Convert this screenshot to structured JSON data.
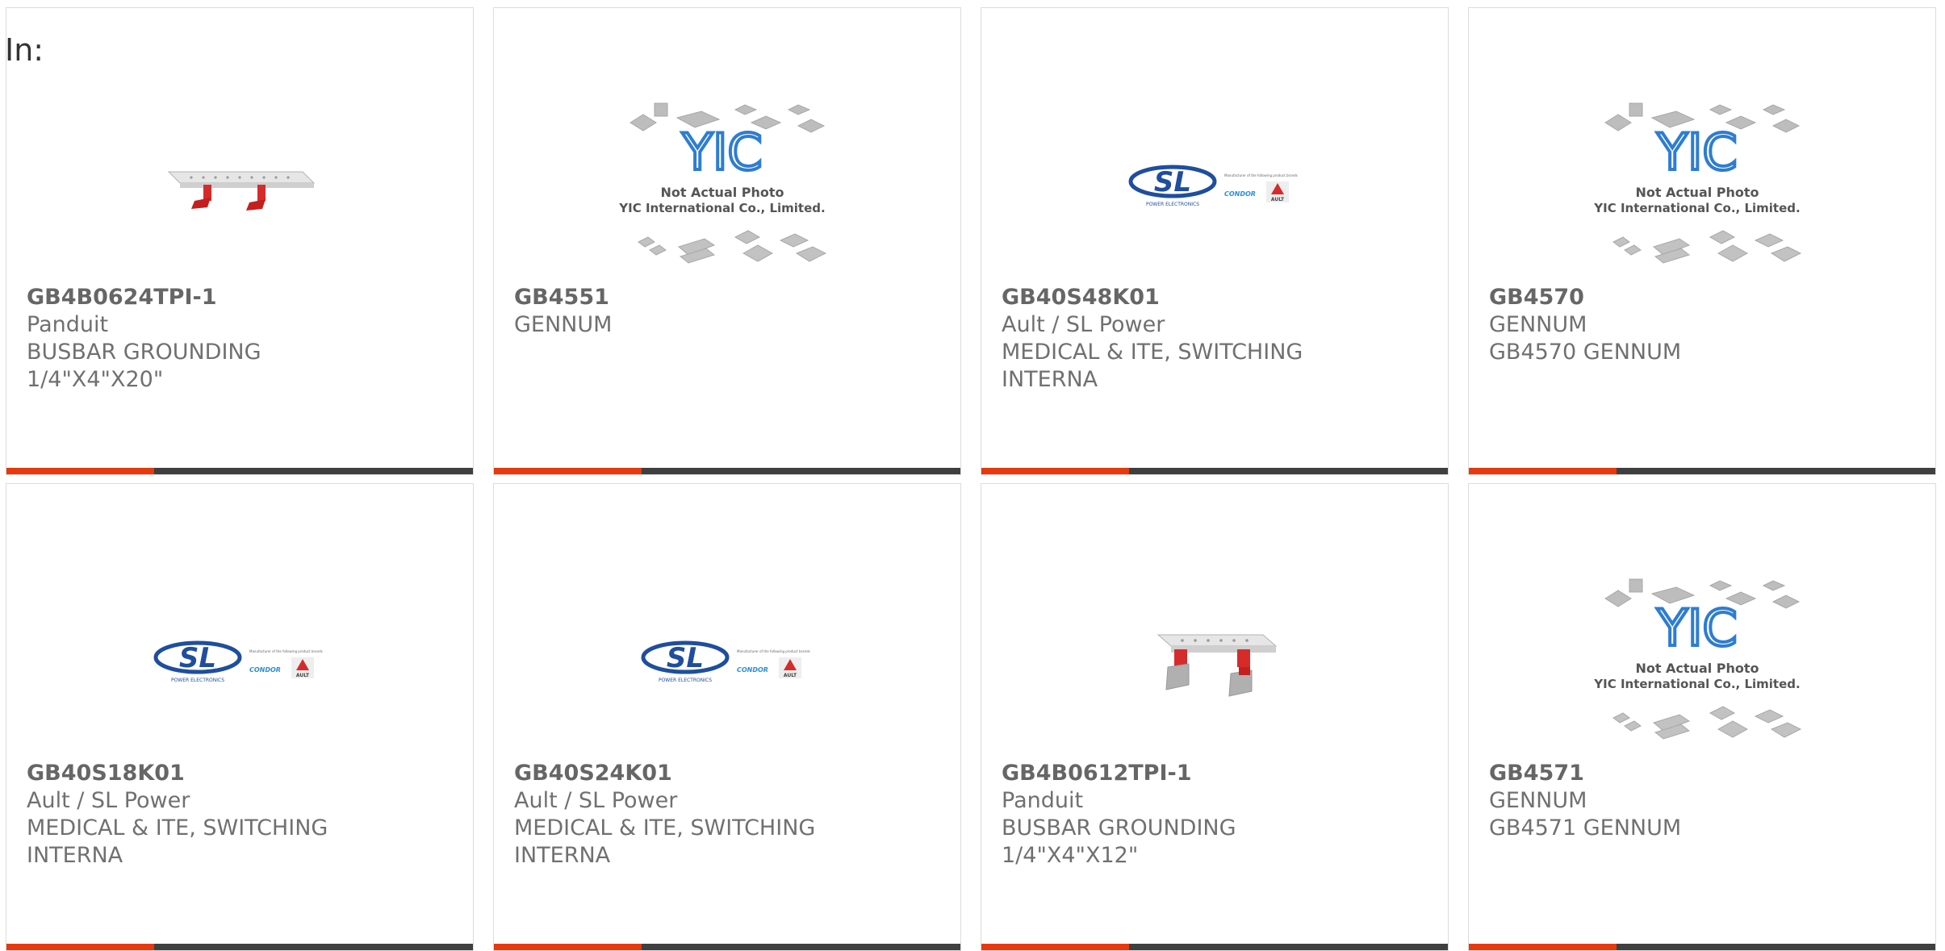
{
  "label": "In:",
  "accent_color": "#e8380d",
  "products": [
    {
      "part": "GB4B0624TPI-1",
      "maker": "Panduit",
      "desc": "BUSBAR GROUNDING",
      "desc2": "1/4\"X4\"X20\"",
      "image": "busbar-long"
    },
    {
      "part": "GB4551",
      "maker": "GENNUM",
      "desc": "",
      "desc2": "",
      "image": "yic-placeholder"
    },
    {
      "part": "GB40S48K01",
      "maker": "Ault / SL Power",
      "desc": "MEDICAL & ITE, SWITCHING",
      "desc2": "INTERNA",
      "image": "sl-power-logo"
    },
    {
      "part": "GB4570",
      "maker": "GENNUM",
      "desc": "GB4570 GENNUM",
      "desc2": "",
      "image": "yic-placeholder"
    },
    {
      "part": "GB40S18K01",
      "maker": "Ault / SL Power",
      "desc": "MEDICAL & ITE, SWITCHING",
      "desc2": "INTERNA",
      "image": "sl-power-logo"
    },
    {
      "part": "GB40S24K01",
      "maker": "Ault / SL Power",
      "desc": "MEDICAL & ITE, SWITCHING",
      "desc2": "INTERNA",
      "image": "sl-power-logo"
    },
    {
      "part": "GB4B0612TPI-1",
      "maker": "Panduit",
      "desc": "BUSBAR GROUNDING",
      "desc2": "1/4\"X4\"X12\"",
      "image": "busbar-short"
    },
    {
      "part": "GB4571",
      "maker": "GENNUM",
      "desc": "GB4571 GENNUM",
      "desc2": "",
      "image": "yic-placeholder"
    }
  ],
  "placeholder": {
    "line1": "Not Actual Photo",
    "line2": "YIC International Co., Limited.",
    "logo_text": "YIC"
  },
  "sl_logo": {
    "brand": "SL",
    "tagline": "POWER ELECTRONICS",
    "sub1": "Manufacturer of the following product brands",
    "condor": "CONDOR",
    "ault": "AULT"
  }
}
